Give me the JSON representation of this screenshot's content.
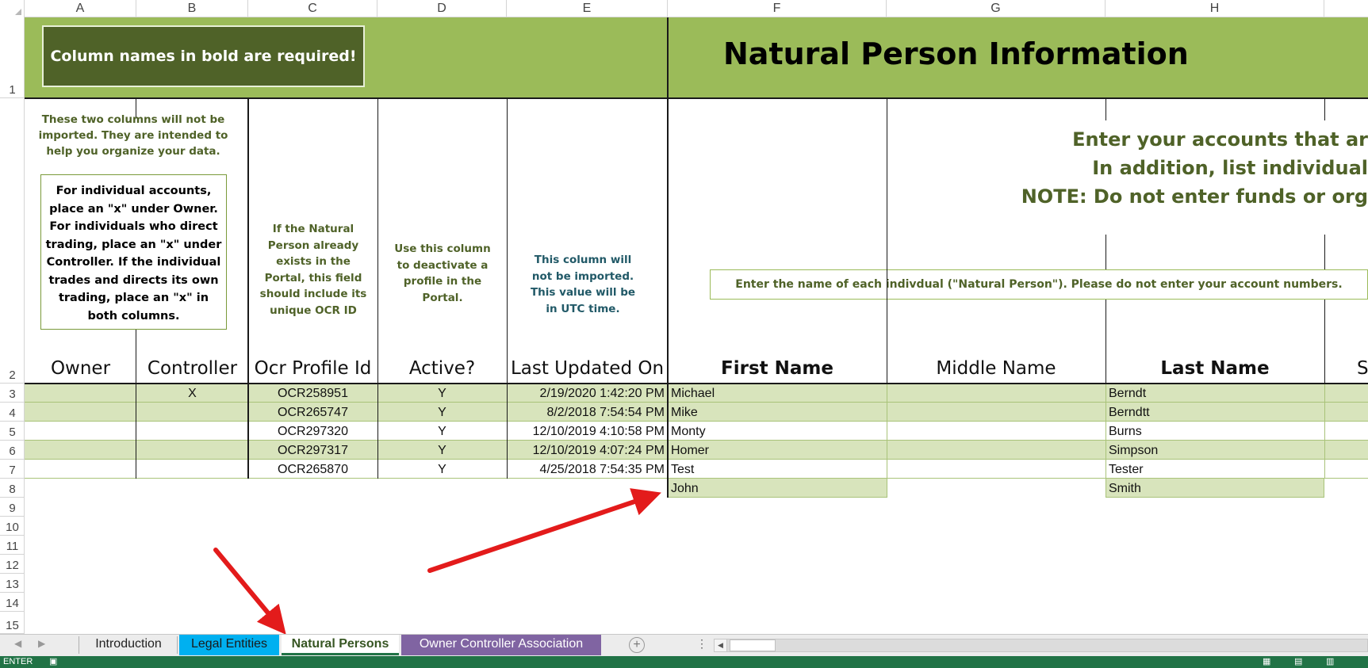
{
  "columns": [
    "A",
    "B",
    "C",
    "D",
    "E",
    "F",
    "G",
    "H"
  ],
  "rows": [
    "1",
    "2",
    "3",
    "4",
    "5",
    "6",
    "7",
    "8",
    "9",
    "10",
    "11",
    "12",
    "13",
    "14",
    "15"
  ],
  "banner": {
    "bold_notice": "Column names in bold are required!",
    "title": "Natural Person Information"
  },
  "notes": {
    "not_imported_lines": [
      "These two columns  will not be",
      "imported. They are intended to",
      "help you organize your data."
    ],
    "instructions_lines": [
      "For individual  accounts,",
      "place an \"x\" under Owner.",
      "For individuals who direct",
      "trading, place an \"x\" under",
      "Controller. If the individual",
      "trades and directs its own",
      "trading, place an \"x\" in",
      "both columns."
    ],
    "ocr_lines": [
      "If the Natural",
      "Person already",
      "exists in the",
      "Portal, this field",
      "should include its",
      "unique OCR ID"
    ],
    "active_lines": [
      "Use this column",
      "to deactivate a",
      "profile in the",
      "Portal."
    ],
    "updated_lines": [
      "This column will",
      "not be imported.",
      "This value will be",
      "in UTC time."
    ],
    "big_lines": [
      "Enter your accounts that ar",
      "In addition, list  individual",
      "NOTE: Do not enter funds or org"
    ],
    "name_instruction": "Enter the name of each indivdual (\"Natural Person\"). Please do not enter your account numbers."
  },
  "headers": {
    "owner": "Owner",
    "controller": "Controller",
    "ocr": "Ocr Profile Id",
    "active": "Active?",
    "updated": "Last Updated On",
    "first": "First Name",
    "middle": "Middle Name",
    "last": "Last Name",
    "next": "S"
  },
  "table": [
    {
      "controller": "X",
      "ocr": "OCR258951",
      "active": "Y",
      "updated": "2/19/2020 1:42:20 PM",
      "first": "Michael",
      "last": "Berndt"
    },
    {
      "controller": "",
      "ocr": "OCR265747",
      "active": "Y",
      "updated": "8/2/2018 7:54:54 PM",
      "first": "Mike",
      "last": "Berndtt"
    },
    {
      "controller": "",
      "ocr": "OCR297320",
      "active": "Y",
      "updated": "12/10/2019 4:10:58 PM",
      "first": "Monty",
      "last": "Burns"
    },
    {
      "controller": "",
      "ocr": "OCR297317",
      "active": "Y",
      "updated": "12/10/2019 4:07:24 PM",
      "first": "Homer",
      "last": "Simpson"
    },
    {
      "controller": "",
      "ocr": "OCR265870",
      "active": "Y",
      "updated": "4/25/2018 7:54:35 PM",
      "first": "Test",
      "last": "Tester"
    },
    {
      "controller": "",
      "ocr": "",
      "active": "",
      "updated": "",
      "first": "John",
      "last": "Smith"
    }
  ],
  "tabs": [
    {
      "label": "Introduction",
      "color": "#ececec"
    },
    {
      "label": "Legal Entities",
      "color": "#00b0f0"
    },
    {
      "label": "Natural Persons",
      "color": "#ffffff"
    },
    {
      "label": "Owner Controller Association",
      "color": "#8064a2"
    }
  ],
  "status": {
    "mode": "ENTER"
  },
  "colors": {
    "banner": "#9bbb59",
    "dark_green": "#4f6228",
    "band": "#d8e4bc",
    "arrow": "#e31b1b",
    "statusbar": "#217346"
  }
}
